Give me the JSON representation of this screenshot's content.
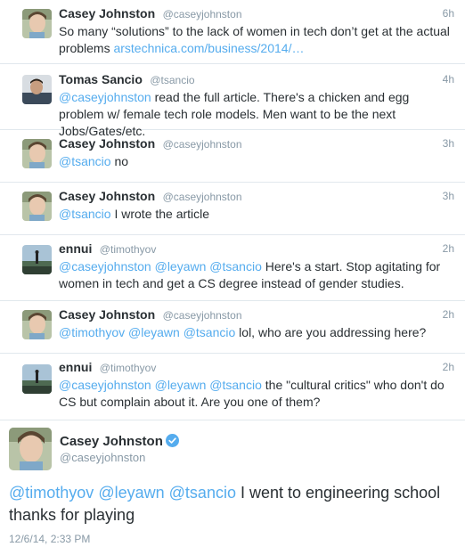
{
  "tweets": [
    {
      "name": "Casey Johnston",
      "handle": "@caseyjohnston",
      "time": "6h",
      "avatar": "casey",
      "text_plain": "So many “solutions” to the lack of women in tech don’t get at the actual problems ",
      "link": "arstechnica.com/business/2014/…"
    },
    {
      "name": "Tomas Sancio",
      "handle": "@tsancio",
      "time": "4h",
      "avatar": "tomas",
      "mention": "@caseyjohnston",
      "text_plain": " read the full article. There's a chicken and egg problem w/ female tech role models. Men want to be the next Jobs/Gates/etc."
    },
    {
      "name": "Casey Johnston",
      "handle": "@caseyjohnston",
      "time": "3h",
      "avatar": "casey",
      "mention": "@tsancio",
      "text_plain": " no"
    },
    {
      "name": "Casey Johnston",
      "handle": "@caseyjohnston",
      "time": "3h",
      "avatar": "casey",
      "mention": "@tsancio",
      "text_plain": " I wrote the article"
    },
    {
      "name": "ennui",
      "handle": "@timothyov",
      "time": "2h",
      "avatar": "ennui",
      "mentions": [
        "@caseyjohnston",
        "@leyawn",
        "@tsancio"
      ],
      "text_plain": " Here's a start. Stop agitating for women in tech and get a CS degree instead of gender studies."
    },
    {
      "name": "Casey Johnston",
      "handle": "@caseyjohnston",
      "time": "2h",
      "avatar": "casey",
      "mentions": [
        "@timothyov",
        "@leyawn",
        "@tsancio"
      ],
      "text_plain": " lol, who are you addressing here?"
    },
    {
      "name": "ennui",
      "handle": "@timothyov",
      "time": "2h",
      "avatar": "ennui",
      "mentions": [
        "@caseyjohnston",
        "@leyawn",
        "@tsancio"
      ],
      "text_plain": " the \"cultural critics\" who don't do CS but complain about it. Are you one of them?"
    }
  ],
  "main_tweet": {
    "name": "Casey Johnston",
    "handle": "@caseyjohnston",
    "verified_icon": "verified-badge-icon",
    "mentions": [
      "@timothyov",
      "@leyawn",
      "@tsancio"
    ],
    "text_plain": " I went to engineering school thanks for playing",
    "date": "12/6/14, 2:33 PM"
  },
  "colors": {
    "link": "#55acee",
    "secondary": "#8899a6",
    "text": "#292f33",
    "divider": "#e1e8ed"
  }
}
